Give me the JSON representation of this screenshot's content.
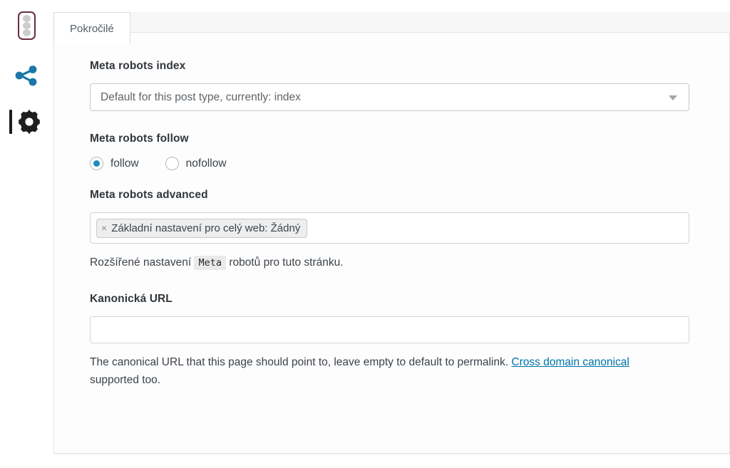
{
  "sidebar": {
    "items": [
      {
        "name": "traffic-light-icon",
        "label": "SEO score"
      },
      {
        "name": "share-icon",
        "label": "Social"
      },
      {
        "name": "gear-icon",
        "label": "Advanced settings",
        "active": true
      }
    ]
  },
  "tabs": [
    {
      "label": "Pokročilé",
      "active": true
    }
  ],
  "fields": {
    "meta_robots_index": {
      "label": "Meta robots index",
      "selected": "Default for this post type, currently: index",
      "arrow_icon": "chevron-down-icon"
    },
    "meta_robots_follow": {
      "label": "Meta robots follow",
      "options": [
        {
          "label": "follow",
          "checked": true
        },
        {
          "label": "nofollow",
          "checked": false
        }
      ]
    },
    "meta_robots_advanced": {
      "label": "Meta robots advanced",
      "chips": [
        {
          "remove_icon": "close-icon",
          "remove_label": "×",
          "text": "Základní nastavení pro celý web: Žádný"
        }
      ],
      "help_prefix": "Rozšířené nastavení",
      "help_code": "Meta",
      "help_suffix": "robotů pro tuto stránku."
    },
    "canonical_url": {
      "label": "Kanonická URL",
      "value": "",
      "placeholder": "",
      "help_prefix": "The canonical URL that this page should point to, leave empty to default to permalink.",
      "help_link": "Cross domain canonical",
      "help_suffix": "supported too."
    }
  },
  "colors": {
    "accent_blue": "#1e8cbe",
    "link_blue": "#0073aa",
    "share_blue": "#1a77a8",
    "traffic_light_border": "#6b2b43",
    "label_text": "#32373c",
    "panel_bg": "#fdfdfd",
    "panel_border": "#e2e4e7"
  }
}
